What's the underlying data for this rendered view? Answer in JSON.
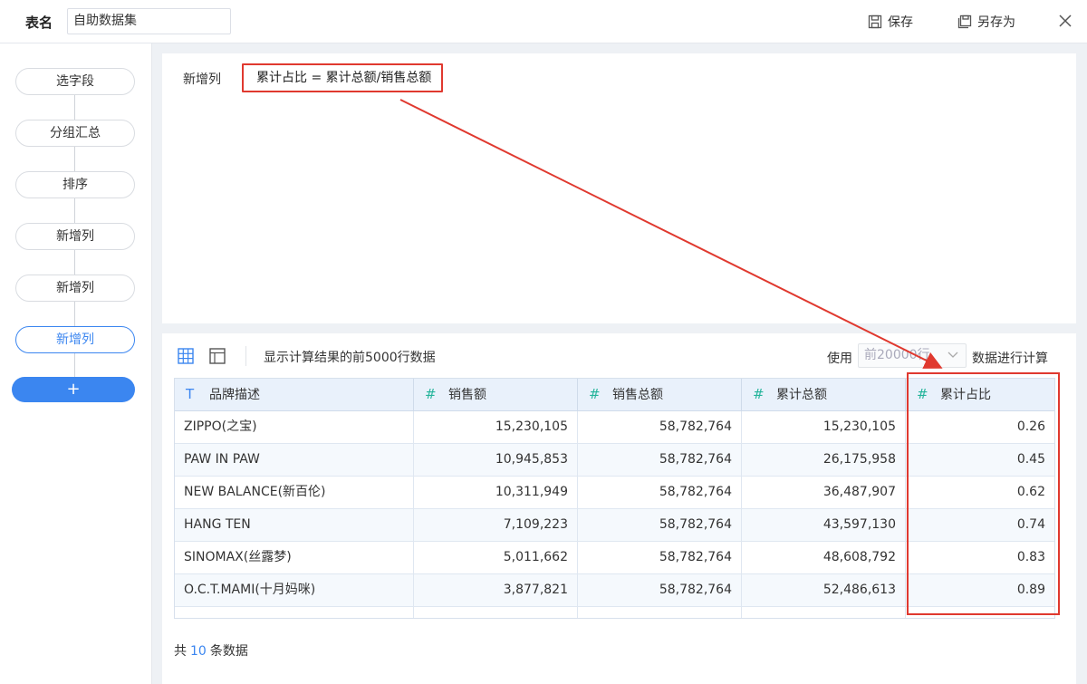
{
  "header": {
    "table_name_label": "表名",
    "table_name_value": "自助数据集",
    "save_label": "保存",
    "save_as_label": "另存为"
  },
  "sidebar": {
    "steps": [
      {
        "label": "选字段"
      },
      {
        "label": "分组汇总"
      },
      {
        "label": "排序"
      },
      {
        "label": "新增列"
      },
      {
        "label": "新增列"
      },
      {
        "label": "新增列"
      }
    ],
    "add_label": "+"
  },
  "formula": {
    "label": "新增列",
    "expression": "累计占比 = 累计总额/销售总额"
  },
  "data_panel": {
    "hint": "显示计算结果的前5000行数据",
    "use_label": "使用",
    "rows_select_value": "前20000行",
    "calc_label": "数据进行计算",
    "columns": [
      {
        "type_icon": "T",
        "label": "品牌描述"
      },
      {
        "type_icon": "#",
        "label": "销售额"
      },
      {
        "type_icon": "#",
        "label": "销售总额"
      },
      {
        "type_icon": "#",
        "label": "累计总额"
      },
      {
        "type_icon": "#",
        "label": "累计占比"
      }
    ],
    "rows": [
      [
        "ZIPPO(之宝)",
        "15,230,105",
        "58,782,764",
        "15,230,105",
        "0.26"
      ],
      [
        "PAW IN PAW",
        "10,945,853",
        "58,782,764",
        "26,175,958",
        "0.45"
      ],
      [
        "NEW BALANCE(新百伦)",
        "10,311,949",
        "58,782,764",
        "36,487,907",
        "0.62"
      ],
      [
        "HANG TEN",
        "7,109,223",
        "58,782,764",
        "43,597,130",
        "0.74"
      ],
      [
        "SINOMAX(丝露梦)",
        "5,011,662",
        "58,782,764",
        "48,608,792",
        "0.83"
      ],
      [
        "O.C.T.MAMI(十月妈咪)",
        "3,877,821",
        "58,782,764",
        "52,486,613",
        "0.89"
      ]
    ],
    "footer_prefix": "共",
    "footer_count": "10",
    "footer_suffix": "条数据"
  },
  "colors": {
    "accent": "#3b86f0",
    "annotation_red": "#e0392f",
    "number_type_icon": "#25b49b"
  }
}
